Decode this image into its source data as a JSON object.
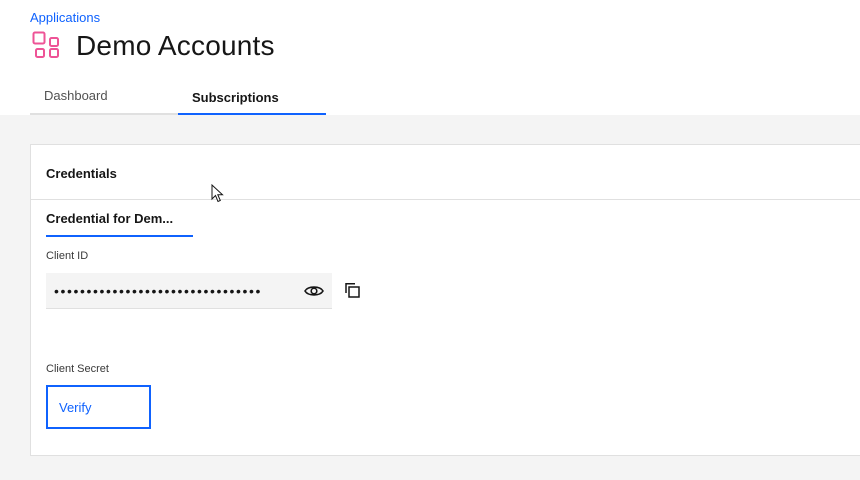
{
  "breadcrumb": {
    "label": "Applications"
  },
  "page": {
    "title": "Demo Accounts",
    "icon": "app-grid-icon"
  },
  "tabs": [
    {
      "label": "Dashboard",
      "active": false
    },
    {
      "label": "Subscriptions",
      "active": true
    }
  ],
  "card": {
    "title": "Credentials",
    "credential_tab": {
      "label": "Credential for Dem..."
    },
    "client_id": {
      "label": "Client ID",
      "value": "••••••••••••••••••••••••••••••••",
      "reveal_icon": "eye-icon",
      "copy_icon": "copy-icon"
    },
    "client_secret": {
      "label": "Client Secret",
      "verify_label": "Verify"
    }
  },
  "colors": {
    "accent": "#0f62fe",
    "icon_pink": "#ee5396",
    "background": "#f4f4f4"
  }
}
